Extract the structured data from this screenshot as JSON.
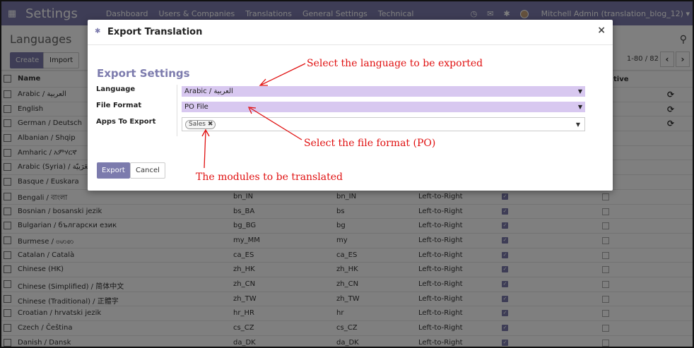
{
  "topnav": {
    "app_name": "Settings",
    "menus": [
      "Dashboard",
      "Users & Companies",
      "Translations",
      "General Settings",
      "Technical"
    ],
    "user": "Mitchell Admin (translation_blog_12)"
  },
  "control_panel": {
    "title": "Languages",
    "create_label": "Create",
    "import_label": "Import",
    "pager": "1-80 / 82"
  },
  "table": {
    "headers": {
      "name": "Name",
      "active": "tive"
    },
    "rows": [
      {
        "name": "Arabic / العربية",
        "code": "",
        "iso": "",
        "dir": "",
        "refresh": true
      },
      {
        "name": "English",
        "code": "",
        "iso": "",
        "dir": "",
        "refresh": true
      },
      {
        "name": "German / Deutsch",
        "code": "",
        "iso": "",
        "dir": "",
        "refresh": true
      },
      {
        "name": "Albanian / Shqip",
        "code": "",
        "iso": "",
        "dir": ""
      },
      {
        "name": "Amharic / አምሃርኛ",
        "code": "",
        "iso": "",
        "dir": ""
      },
      {
        "name": "Arabic (Syria) / الْعَرَبيّة",
        "code": "",
        "iso": "",
        "dir": ""
      },
      {
        "name": "Basque / Euskara",
        "code": "",
        "iso": "",
        "dir": ""
      },
      {
        "name": "Bengali / বাংলা",
        "code": "bn_IN",
        "iso": "bn_IN",
        "dir": "Left-to-Right"
      },
      {
        "name": "Bosnian / bosanski jezik",
        "code": "bs_BA",
        "iso": "bs",
        "dir": "Left-to-Right"
      },
      {
        "name": "Bulgarian / български език",
        "code": "bg_BG",
        "iso": "bg",
        "dir": "Left-to-Right"
      },
      {
        "name": "Burmese / ဗမာစာ",
        "code": "my_MM",
        "iso": "my",
        "dir": "Left-to-Right"
      },
      {
        "name": "Catalan / Català",
        "code": "ca_ES",
        "iso": "ca_ES",
        "dir": "Left-to-Right"
      },
      {
        "name": "Chinese (HK)",
        "code": "zh_HK",
        "iso": "zh_HK",
        "dir": "Left-to-Right"
      },
      {
        "name": "Chinese (Simplified) / 简体中文",
        "code": "zh_CN",
        "iso": "zh_CN",
        "dir": "Left-to-Right"
      },
      {
        "name": "Chinese (Traditional) / 正體字",
        "code": "zh_TW",
        "iso": "zh_TW",
        "dir": "Left-to-Right"
      },
      {
        "name": "Croatian / hrvatski jezik",
        "code": "hr_HR",
        "iso": "hr",
        "dir": "Left-to-Right"
      },
      {
        "name": "Czech / Čeština",
        "code": "cs_CZ",
        "iso": "cs_CZ",
        "dir": "Left-to-Right"
      },
      {
        "name": "Danish / Dansk",
        "code": "da_DK",
        "iso": "da_DK",
        "dir": "Left-to-Right"
      }
    ]
  },
  "modal": {
    "title": "Export Translation",
    "settings_title": "Export Settings",
    "language_label": "Language",
    "language_value": "Arabic / العربية",
    "format_label": "File Format",
    "format_value": "PO File",
    "apps_label": "Apps To Export",
    "apps_tag": "Sales",
    "export_label": "Export",
    "cancel_label": "Cancel"
  },
  "annotations": {
    "language": "Select the language to be exported",
    "format": "Select the file format (PO)",
    "modules": "The modules to be translated"
  },
  "colors": {
    "brand": "#7c7bad",
    "select_bg": "#d8c8f0",
    "annotation": "#e01010"
  }
}
